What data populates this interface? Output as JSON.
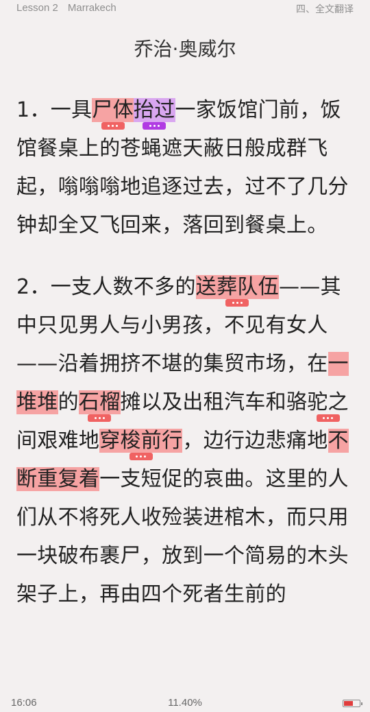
{
  "header": {
    "lesson": "Lesson 2",
    "place": "Marrakech",
    "section": "四、全文翻译"
  },
  "title": "乔治·奥威尔",
  "para1": {
    "num": "1．",
    "t1": "一具",
    "h1": "尸体",
    "h2": "抬过",
    "t2": "一家饭馆门前，饭馆餐桌上的苍蝇遮天蔽日般成群飞起，嗡嗡嗡地追逐过去，过不了几分钟却全又飞回来，落回到餐桌上。"
  },
  "para2": {
    "num": "2．",
    "t1": "一支人数不多的",
    "h1": "送葬队伍",
    "t2": "——其中只见男人与小男孩，不见有女人——沿着拥挤不堪的集贸市场，在",
    "h2": "一堆堆",
    "t3": "的",
    "h3": "石榴",
    "t4": "摊以及出租汽车和骆驼之间艰难地",
    "h4": "穿梭前行",
    "t5": "，边行边悲痛地",
    "h5": "不断重复着",
    "t6": "一支短促的哀曲。这里的人们从不将死人收殓装进棺木，而只用一块破布裹尸，放到一个简易的木头架子上，再由四个死者生前的"
  },
  "footer": {
    "time": "16:06",
    "progress": "11.40%",
    "battery_level": 0.6
  },
  "colors": {
    "highlight": "#f6a3a3",
    "highlight_purple": "#d9a7f0",
    "note_marker": "#f06262",
    "note_marker_purple": "#b13be3"
  }
}
